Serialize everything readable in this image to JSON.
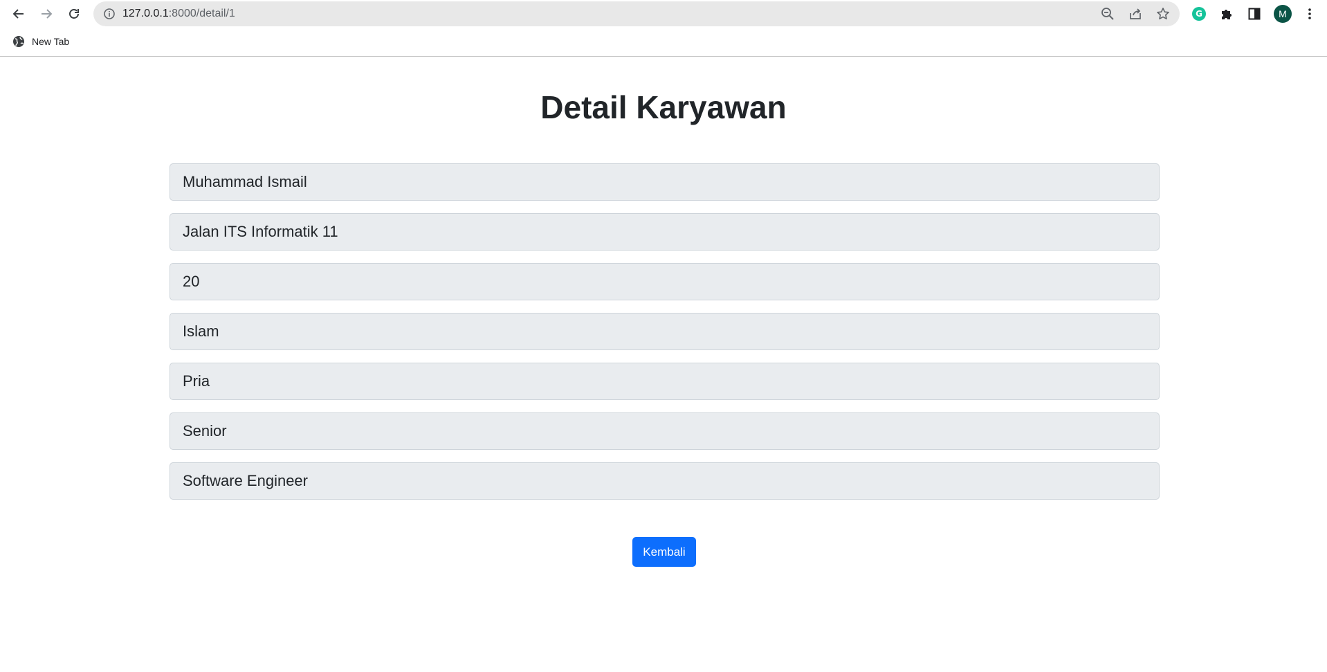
{
  "browser": {
    "url_host": "127.0.0.1",
    "url_rest": ":8000/detail/1",
    "avatar_initial": "M",
    "grammarly_letter": "G",
    "icons": {
      "back": "arrow-left-icon",
      "forward": "arrow-right-icon",
      "reload": "reload-icon",
      "site_info": "info-icon",
      "zoom": "magnifier-minus-icon",
      "share": "share-icon",
      "bookmark_star": "star-icon",
      "extensions": "puzzle-icon",
      "side_panel": "side-panel-icon",
      "menu": "kebab-menu-icon"
    }
  },
  "bookmarks": {
    "items": [
      {
        "label": "New Tab",
        "icon": "globe-icon"
      }
    ]
  },
  "page": {
    "title": "Detail Karyawan",
    "fields": [
      {
        "value": "Muhammad Ismail"
      },
      {
        "value": "Jalan ITS Informatik 11"
      },
      {
        "value": "20"
      },
      {
        "value": "Islam"
      },
      {
        "value": "Pria"
      },
      {
        "value": "Senior"
      },
      {
        "value": "Software Engineer"
      }
    ],
    "back_button_label": "Kembali"
  },
  "colors": {
    "primary_button": "#0d6efd",
    "field_background": "#e9ecef",
    "field_border": "#ced4da",
    "text": "#212529"
  }
}
